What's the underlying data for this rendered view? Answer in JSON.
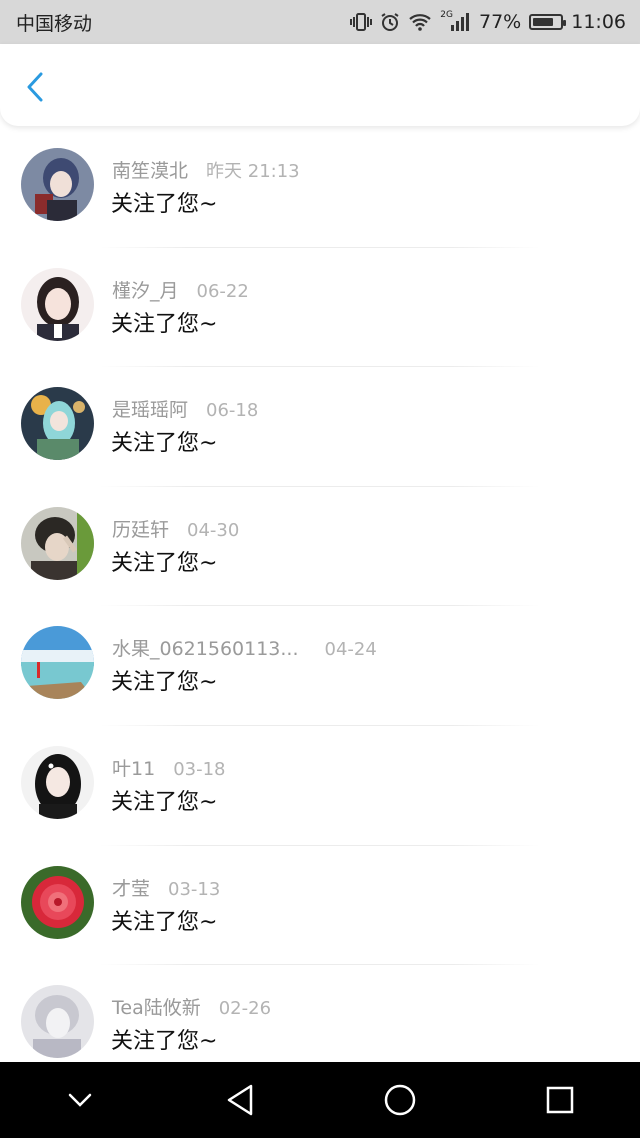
{
  "status_bar": {
    "carrier": "中国移动",
    "network_tag": "2G",
    "battery_percent": "77%",
    "battery_level": 0.77,
    "time": "11:06",
    "icons": [
      "vibrate-icon",
      "alarm-icon",
      "wifi-icon",
      "signal-icon",
      "battery-icon"
    ]
  },
  "header": {
    "back_icon": "chevron-left-icon",
    "accent_color": "#2a9ae0"
  },
  "followers": [
    {
      "name": "南笙漠北",
      "time": "昨天 21:13",
      "message": "关注了您~"
    },
    {
      "name": "槿汐_月",
      "time": "06-22",
      "message": "关注了您~"
    },
    {
      "name": "是瑶瑶阿",
      "time": "06-18",
      "message": "关注了您~"
    },
    {
      "name": "历廷轩",
      "time": "04-30",
      "message": "关注了您~"
    },
    {
      "name": "水果_0621560113...",
      "time": "04-24",
      "message": "关注了您~"
    },
    {
      "name": "叶11",
      "time": "03-18",
      "message": "关注了您~"
    },
    {
      "name": "才莹",
      "time": "03-13",
      "message": "关注了您~"
    },
    {
      "name": "Tea陆攸新",
      "time": "02-26",
      "message": "关注了您~"
    }
  ],
  "nav_bar": {
    "buttons": [
      "chevron-down-icon",
      "back-triangle-icon",
      "home-circle-icon",
      "recents-square-icon"
    ]
  }
}
